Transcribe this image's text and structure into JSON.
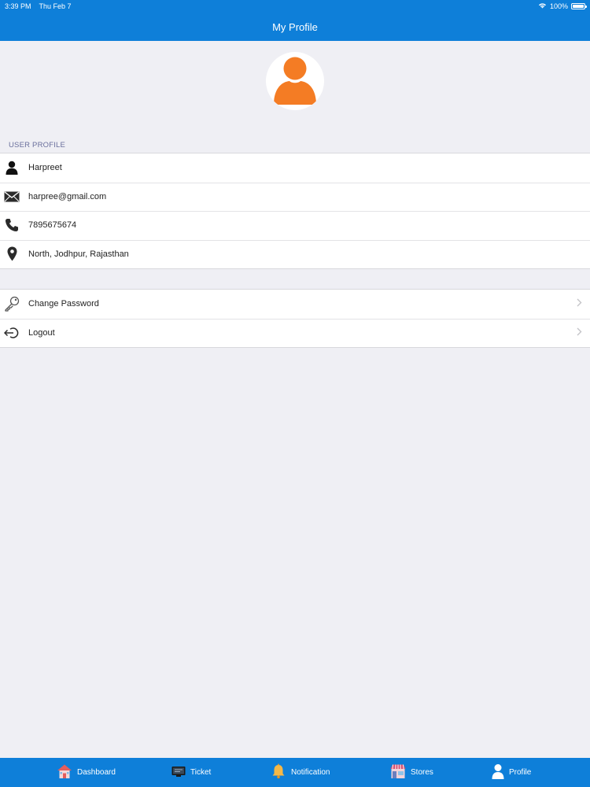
{
  "status_bar": {
    "time": "3:39 PM",
    "date": "Thu Feb 7",
    "battery": "100%",
    "icons": [
      "wifi-icon",
      "battery-icon"
    ]
  },
  "nav": {
    "title": "My Profile"
  },
  "profile": {
    "section_label": "USER PROFILE",
    "name": "Harpreet",
    "email": "harpree@gmail.com",
    "phone": "7895675674",
    "address": "North, Jodhpur, Rajasthan"
  },
  "actions": {
    "change_password": "Change Password",
    "logout": "Logout"
  },
  "tabs": [
    {
      "label": "Dashboard",
      "icon": "house-icon"
    },
    {
      "label": "Ticket",
      "icon": "ticket-icon"
    },
    {
      "label": "Notification",
      "icon": "bell-icon"
    },
    {
      "label": "Stores",
      "icon": "store-icon"
    },
    {
      "label": "Profile",
      "icon": "user-icon"
    }
  ],
  "colors": {
    "brand_blue": "#0e7fd9",
    "avatar_orange": "#f47c24",
    "background": "#efeff4",
    "section_header": "#6a6f9c"
  }
}
